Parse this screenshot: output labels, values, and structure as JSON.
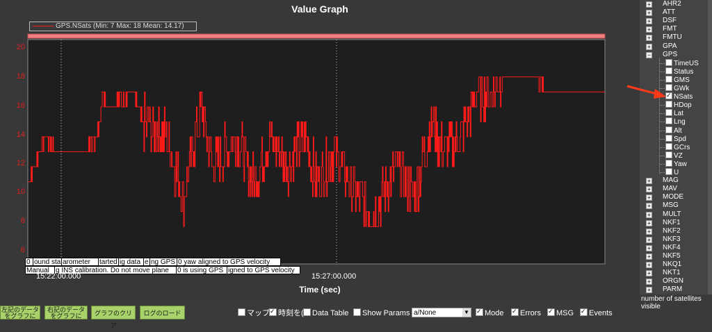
{
  "graph": {
    "title": "Value Graph",
    "legend": "GPS.NSats  (Min: 7 Max: 18 Mean: 14.17)",
    "xlabel": "Time (sec)",
    "xticks": [
      "15:22:00.000",
      "15:27:00.000"
    ],
    "yticks": [
      "20",
      "18",
      "16",
      "14",
      "12",
      "10",
      "8",
      "6"
    ],
    "events_row1": [
      "0",
      "ound start",
      "arometer",
      "tarted",
      "ig data",
      "e",
      "ng GPS",
      "0 yaw aligned to GPS velocity"
    ],
    "events_row2": [
      "Manual",
      "g INS calibration. Do not move plane",
      "0 is using GPS",
      "igned to GPS velocity"
    ],
    "colors": {
      "series": "#ff1a1a",
      "plot_bg": "#1e1e1e",
      "tick": "#e02020"
    }
  },
  "chart_data": {
    "type": "line",
    "title": "Value Graph",
    "xlabel": "Time (sec)",
    "ylabel": "",
    "ylim": [
      5.5,
      20.5
    ],
    "series": [
      {
        "name": "GPS.NSats",
        "stats": {
          "min": 7,
          "max": 18,
          "mean": 14.17
        },
        "keypoints": [
          [
            0,
            11
          ],
          [
            0.01,
            12
          ],
          [
            0.03,
            14
          ],
          [
            0.05,
            13
          ],
          [
            0.1,
            13
          ],
          [
            0.12,
            14
          ],
          [
            0.13,
            17
          ],
          [
            0.14,
            16
          ],
          [
            0.18,
            17
          ],
          [
            0.2,
            15
          ],
          [
            0.24,
            14
          ],
          [
            0.27,
            10
          ],
          [
            0.3,
            16
          ],
          [
            0.32,
            12
          ],
          [
            0.36,
            14
          ],
          [
            0.39,
            11
          ],
          [
            0.42,
            14
          ],
          [
            0.45,
            12
          ],
          [
            0.48,
            14
          ],
          [
            0.5,
            11
          ],
          [
            0.53,
            13
          ],
          [
            0.57,
            10
          ],
          [
            0.6,
            9
          ],
          [
            0.64,
            12
          ],
          [
            0.67,
            10
          ],
          [
            0.7,
            15
          ],
          [
            0.72,
            13
          ],
          [
            0.75,
            14
          ],
          [
            0.78,
            17
          ],
          [
            0.8,
            17
          ],
          [
            0.83,
            18
          ],
          [
            0.88,
            18
          ],
          [
            0.9,
            17
          ],
          [
            1,
            17
          ]
        ]
      }
    ]
  },
  "tree": {
    "items": [
      {
        "label": "AHR2",
        "type": "group"
      },
      {
        "label": "ATT",
        "type": "group"
      },
      {
        "label": "DSF",
        "type": "group"
      },
      {
        "label": "FMT",
        "type": "group"
      },
      {
        "label": "FMTU",
        "type": "group"
      },
      {
        "label": "GPA",
        "type": "group"
      },
      {
        "label": "GPS",
        "type": "group-open"
      },
      {
        "label": "TimeUS",
        "type": "field"
      },
      {
        "label": "Status",
        "type": "field"
      },
      {
        "label": "GMS",
        "type": "field"
      },
      {
        "label": "GWk",
        "type": "field"
      },
      {
        "label": "NSats",
        "type": "field",
        "checked": true
      },
      {
        "label": "HDop",
        "type": "field"
      },
      {
        "label": "Lat",
        "type": "field"
      },
      {
        "label": "Lng",
        "type": "field"
      },
      {
        "label": "Alt",
        "type": "field"
      },
      {
        "label": "Spd",
        "type": "field"
      },
      {
        "label": "GCrs",
        "type": "field"
      },
      {
        "label": "VZ",
        "type": "field"
      },
      {
        "label": "Yaw",
        "type": "field"
      },
      {
        "label": "U",
        "type": "field"
      },
      {
        "label": "MAG",
        "type": "group"
      },
      {
        "label": "MAV",
        "type": "group"
      },
      {
        "label": "MODE",
        "type": "group"
      },
      {
        "label": "MSG",
        "type": "group"
      },
      {
        "label": "MULT",
        "type": "group"
      },
      {
        "label": "NKF1",
        "type": "group"
      },
      {
        "label": "NKF2",
        "type": "group"
      },
      {
        "label": "NKF3",
        "type": "group"
      },
      {
        "label": "NKF4",
        "type": "group"
      },
      {
        "label": "NKF5",
        "type": "group"
      },
      {
        "label": "NKQ1",
        "type": "group"
      },
      {
        "label": "NKT1",
        "type": "group"
      },
      {
        "label": "ORGN",
        "type": "group"
      },
      {
        "label": "PARM",
        "type": "group"
      }
    ],
    "status": "number of satellites visible"
  },
  "toolbar": {
    "btn_left_graph": "左記のデータ\nをグラフに",
    "btn_right_graph": "右記のデータ\nをグラフに",
    "btn_clear": "グラフのクリア",
    "btn_load": "ログのロード",
    "cb_map": "マップの",
    "cb_time": "時刻を(",
    "cb_data_table": "Data Table",
    "cb_show_params": "Show Params",
    "range_value": "a/None",
    "cb_mode": "Mode",
    "cb_errors": "Errors",
    "cb_msg": "MSG",
    "cb_events": "Events"
  }
}
